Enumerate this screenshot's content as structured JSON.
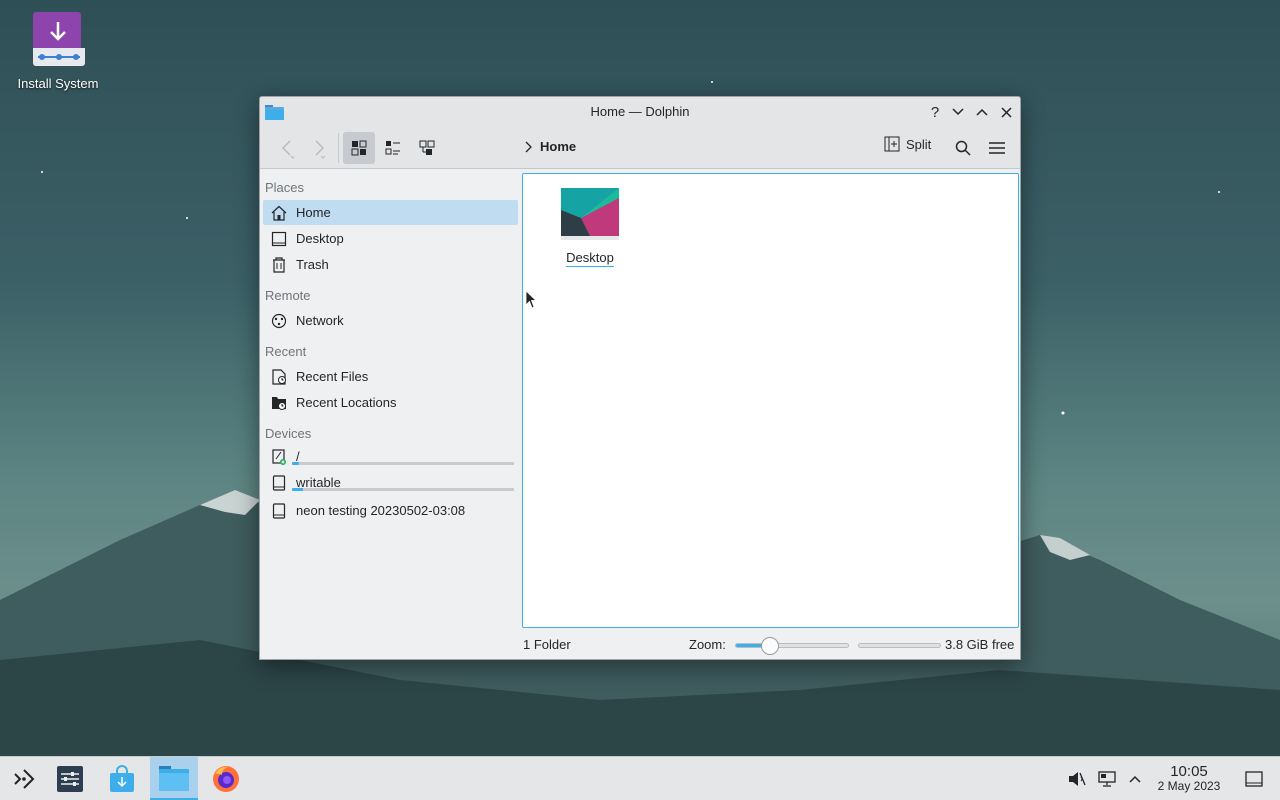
{
  "desktop": {
    "icons": [
      {
        "label": "Install System",
        "icon": "install-system-icon"
      }
    ]
  },
  "window": {
    "title": "Home — Dolphin",
    "app_icon": "folder-icon",
    "controls": {
      "help": "?",
      "minimize": "minimize",
      "maximize": "maximize",
      "close": "close"
    }
  },
  "toolbar": {
    "back": "back-arrow-icon",
    "forward": "forward-arrow-icon",
    "view_modes": [
      "icons-view",
      "compact-view",
      "details-view"
    ],
    "active_view": "icons-view",
    "breadcrumb": [
      "Home"
    ],
    "split_label": "Split",
    "search": "search-icon",
    "menu": "hamburger-menu-icon"
  },
  "sidebar": {
    "places_header": "Places",
    "places": [
      {
        "label": "Home",
        "icon": "home-icon",
        "selected": true
      },
      {
        "label": "Desktop",
        "icon": "desktop-icon"
      },
      {
        "label": "Trash",
        "icon": "trash-icon"
      }
    ],
    "remote_header": "Remote",
    "remote": [
      {
        "label": "Network",
        "icon": "network-icon"
      }
    ],
    "recent_header": "Recent",
    "recent": [
      {
        "label": "Recent Files",
        "icon": "recent-files-icon"
      },
      {
        "label": "Recent Locations",
        "icon": "recent-locations-icon"
      }
    ],
    "devices_header": "Devices",
    "devices": [
      {
        "label": "/",
        "icon": "drive-root-icon",
        "usage": 0.03
      },
      {
        "label": "writable",
        "icon": "drive-icon",
        "usage": 0.05
      },
      {
        "label": "neon testing 20230502-03:08",
        "icon": "drive-icon"
      }
    ]
  },
  "content": {
    "items": [
      {
        "name": "Desktop",
        "type": "folder-thumbnail"
      }
    ]
  },
  "statusbar": {
    "summary": "1 Folder",
    "zoom_label": "Zoom:",
    "zoom_level": 0.3,
    "free_space": "3.8 GiB free"
  },
  "taskbar": {
    "launchers": [
      "app-launcher-icon",
      "system-settings-icon",
      "discover-store-icon",
      "dolphin-file-manager-icon",
      "firefox-icon"
    ],
    "active_launcher": "dolphin-file-manager-icon",
    "tray": [
      "volume-muted-icon",
      "network-wired-icon",
      "tray-expand-icon"
    ],
    "clock_time": "10:05",
    "clock_date": "2 May 2023",
    "show_desktop": "show-desktop-icon"
  }
}
